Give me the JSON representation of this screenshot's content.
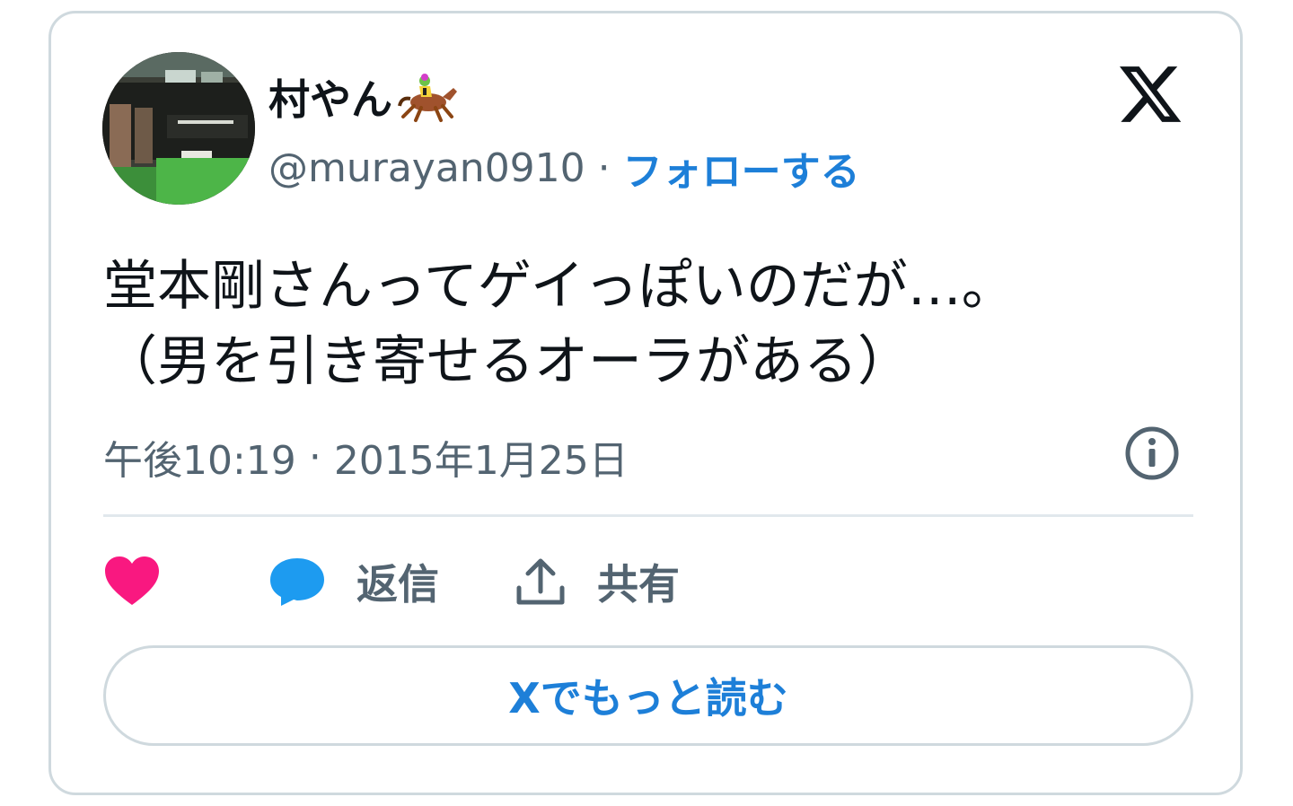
{
  "user": {
    "display_name": "村やん",
    "name_emoji": "🏇",
    "handle": "@murayan0910",
    "separator": "·",
    "follow_label": "フォローする"
  },
  "tweet": {
    "lines": [
      "堂本剛さんってゲイっぽいのだが…。",
      "（男を引き寄せるオーラがある）"
    ],
    "time": "午後10:19",
    "separator": "·",
    "date": "2015年1月25日"
  },
  "actions": {
    "reply_label": "返信",
    "share_label": "共有"
  },
  "read_more_label": "Xでもっと読む",
  "colors": {
    "accent_blue": "#1d7fd8",
    "like_pink": "#f91880",
    "reply_blue": "#1d9bf0",
    "secondary_text": "#536471",
    "border": "#cfd9de"
  },
  "icons": [
    "x-logo-icon",
    "info-icon",
    "heart-icon",
    "reply-bubble-icon",
    "share-icon",
    "horse-racing-emoji"
  ]
}
